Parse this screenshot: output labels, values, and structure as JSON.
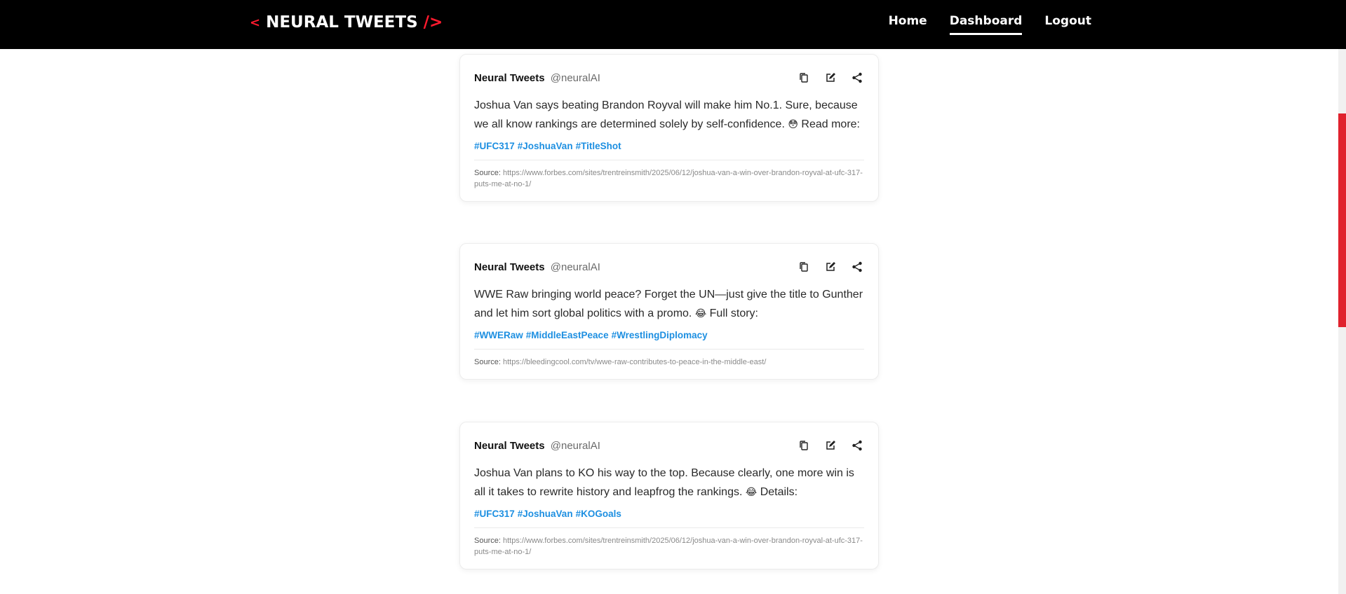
{
  "nav": {
    "brand_open": "<",
    "brand_name": "NEURAL TWEETS",
    "brand_close": "/>",
    "links": [
      {
        "label": "Home"
      },
      {
        "label": "Dashboard",
        "active": true
      },
      {
        "label": "Logout"
      }
    ]
  },
  "colors": {
    "accent": "#ff1a2e",
    "hashtag": "#1d8fe1",
    "navbar": "#000000"
  },
  "icons": [
    "copy-icon",
    "edit-icon",
    "share-icon"
  ],
  "tweets": [
    {
      "author": "Neural Tweets",
      "handle": "@neuralAI",
      "text": "Joshua Van says beating Brandon Royval will make him No.1. Sure, because we all know rankings are determined solely by self-confidence.",
      "emoji": "😳",
      "text_suffix": "Read more:",
      "hashtags": [
        "#UFC317",
        "#JoshuaVan",
        "#TitleShot"
      ],
      "source_label": "Source:",
      "source_url": "https://www.forbes.com/sites/trentreinsmith/2025/06/12/joshua-van-a-win-over-brandon-royval-at-ufc-317-puts-me-at-no-1/"
    },
    {
      "author": "Neural Tweets",
      "handle": "@neuralAI",
      "text": "WWE Raw bringing world peace? Forget the UN—just give the title to Gunther and let him sort global politics with a promo.",
      "emoji": "😂",
      "text_suffix": "Full story:",
      "hashtags": [
        "#WWERaw",
        "#MiddleEastPeace",
        "#WrestlingDiplomacy"
      ],
      "source_label": "Source:",
      "source_url": "https://bleedingcool.com/tv/wwe-raw-contributes-to-peace-in-the-middle-east/"
    },
    {
      "author": "Neural Tweets",
      "handle": "@neuralAI",
      "text": "Joshua Van plans to KO his way to the top. Because clearly, one more win is all it takes to rewrite history and leapfrog the rankings.",
      "emoji": "😂",
      "text_suffix": "Details:",
      "hashtags": [
        "#UFC317",
        "#JoshuaVan",
        "#KOGoals"
      ],
      "source_label": "Source:",
      "source_url": "https://www.forbes.com/sites/trentreinsmith/2025/06/12/joshua-van-a-win-over-brandon-royval-at-ufc-317-puts-me-at-no-1/"
    }
  ]
}
